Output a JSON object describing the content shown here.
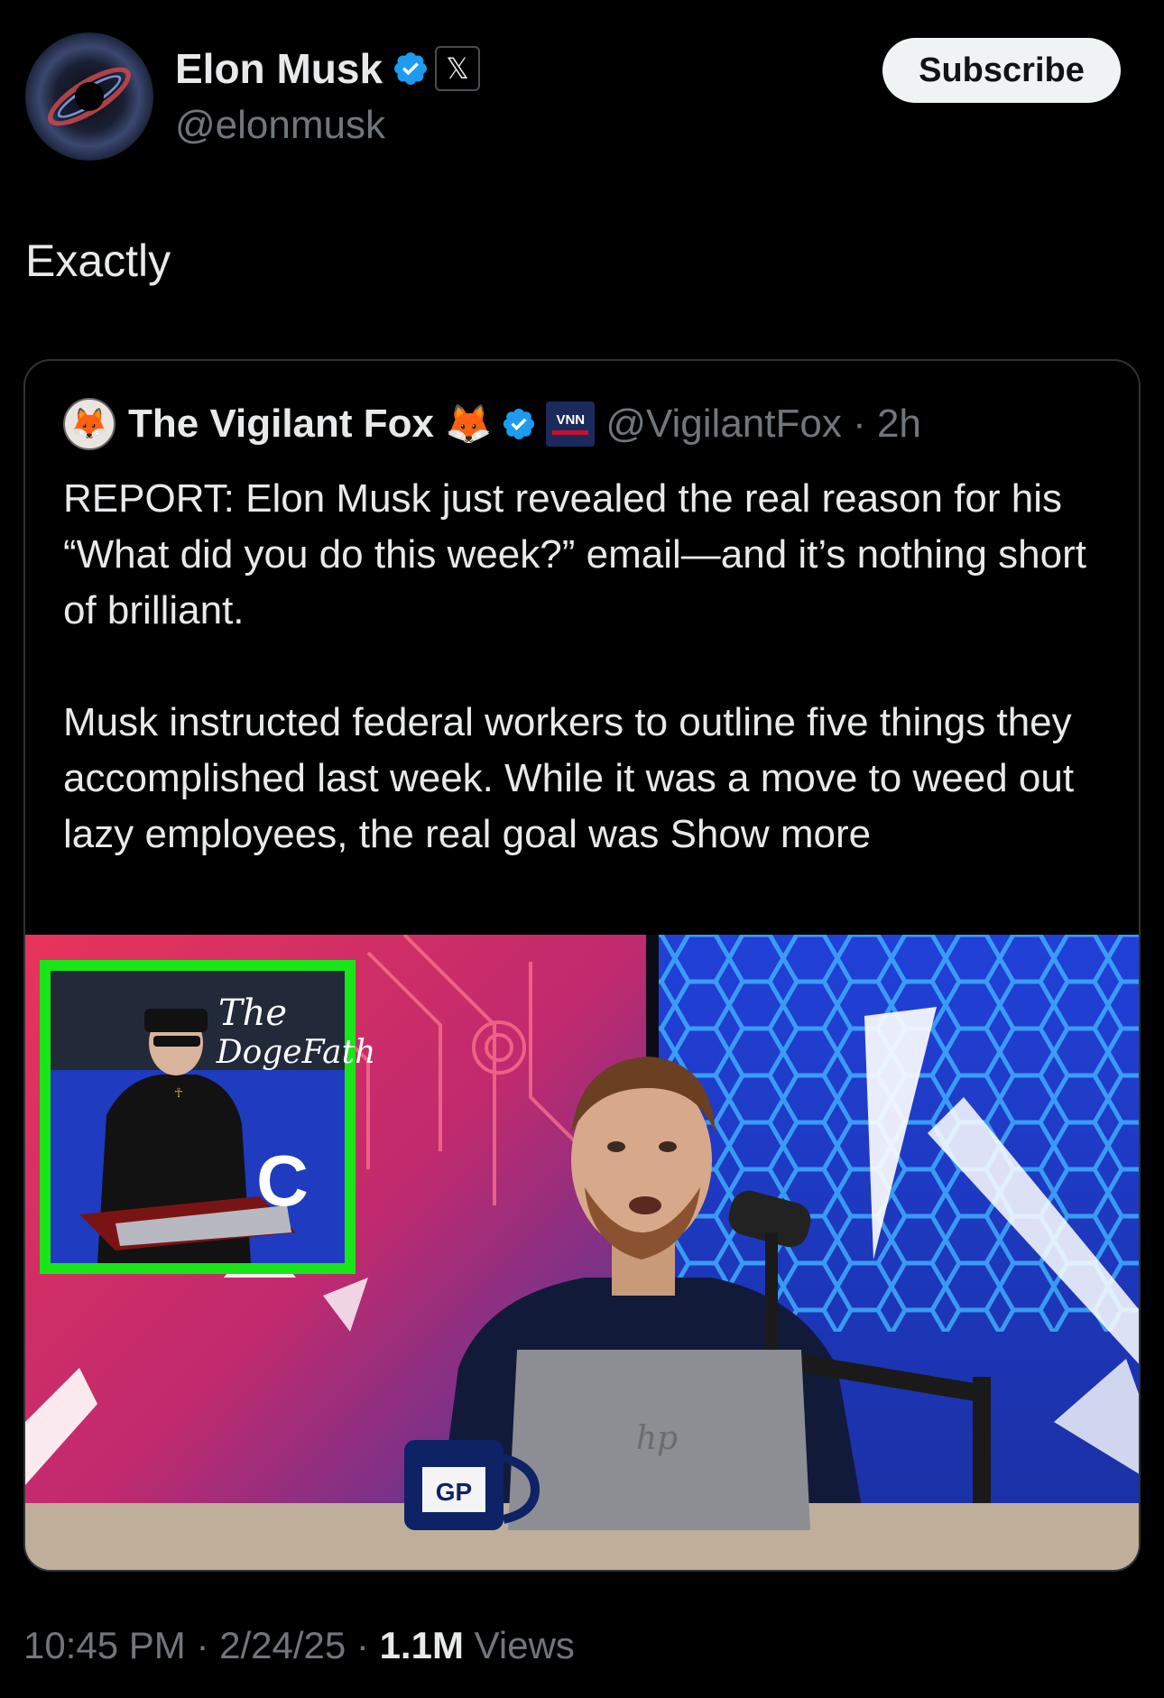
{
  "author": {
    "name": "Elon Musk",
    "handle": "@elonmusk",
    "verified_icon": "verified-badge-icon",
    "affiliation_icon": "x-logo-icon",
    "affiliation_glyph": "𝕏"
  },
  "subscribe_label": "Subscribe",
  "tweet_text": "Exactly",
  "quoted": {
    "name": "The Vigilant Fox",
    "emoji": "🦊",
    "affiliation_label": "VNN",
    "handle": "@VigilantFox",
    "time": "2h",
    "paragraph1": "REPORT: Elon Musk just revealed the real reason for his “What did you do this week?” email—and it’s nothing short of brilliant.",
    "paragraph2_text": "Musk instructed federal workers to outline five things they accomplished last week. While it was a move to weed out lazy employees, the real goal was",
    "show_more": "Show more",
    "media": {
      "inset_title_line1": "The",
      "inset_title_line2": "DogeFath",
      "mug_label": "GP"
    }
  },
  "meta": {
    "time": "10:45 PM",
    "date": "2/24/25",
    "views_count": "1.1M",
    "views_label": "Views"
  },
  "colors": {
    "verified": "#1d9bf0",
    "background": "#000000",
    "muted": "#71767b",
    "text": "#e7e9ea",
    "inset_border": "#19e619"
  }
}
